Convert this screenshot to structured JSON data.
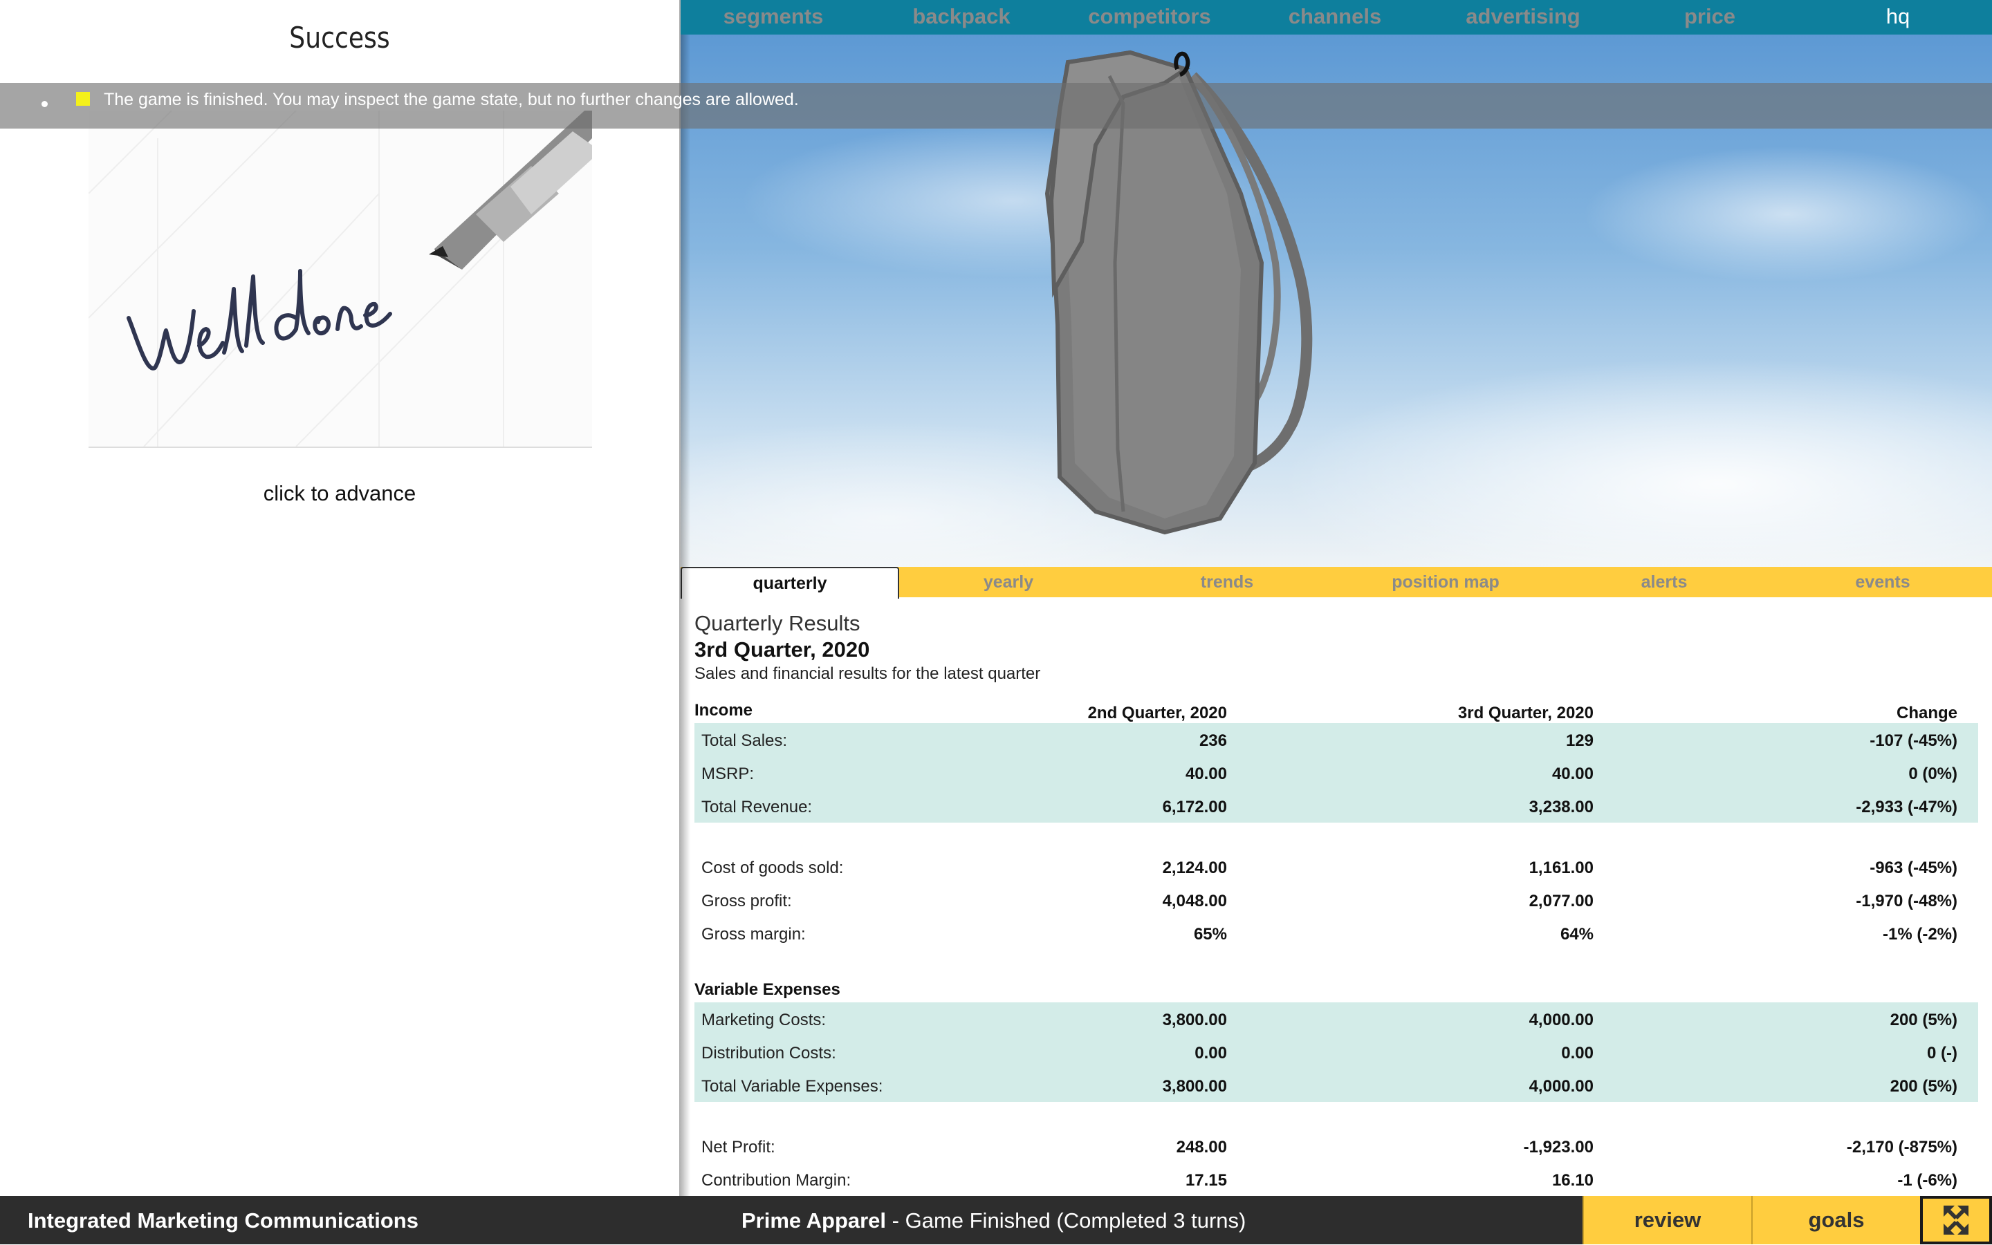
{
  "success_panel": {
    "title": "Success",
    "advance_label": "click to advance",
    "image_alt": "Well done"
  },
  "notice": {
    "text": "The game is finished. You may inspect the game state, but no further changes are allowed.",
    "marker_color": "#f4f11a"
  },
  "top_nav": {
    "items": [
      {
        "label": "segments"
      },
      {
        "label": "backpack"
      },
      {
        "label": "competitors"
      },
      {
        "label": "channels"
      },
      {
        "label": "advertising"
      },
      {
        "label": "price"
      },
      {
        "label": "hq"
      }
    ],
    "background": "#0e7f9d"
  },
  "tabs": {
    "items": [
      {
        "label": "quarterly",
        "active": true
      },
      {
        "label": "yearly"
      },
      {
        "label": "trends"
      },
      {
        "label": "position map"
      },
      {
        "label": "alerts"
      },
      {
        "label": "events"
      }
    ],
    "accent": "#ffcd3f"
  },
  "results": {
    "heading": "Quarterly Results",
    "period": "3rd Quarter, 2020",
    "description": "Sales and financial results for the latest quarter",
    "income_header": "Income",
    "variable_header": "Variable Expenses",
    "columns": [
      "2nd Quarter, 2020",
      "3rd Quarter, 2020",
      "Change"
    ],
    "rows": [
      {
        "label": "Total Sales:",
        "q2": "236",
        "q3": "129",
        "change": "-107 (-45%)"
      },
      {
        "label": "MSRP:",
        "q2": "40.00",
        "q3": "40.00",
        "change": "0 (0%)"
      },
      {
        "label": "Total Revenue:",
        "q2": "6,172.00",
        "q3": "3,238.00",
        "change": "-2,933 (-47%)"
      },
      {
        "label": "Cost of goods sold:",
        "q2": "2,124.00",
        "q3": "1,161.00",
        "change": "-963 (-45%)"
      },
      {
        "label": "Gross profit:",
        "q2": "4,048.00",
        "q3": "2,077.00",
        "change": "-1,970 (-48%)"
      },
      {
        "label": "Gross margin:",
        "q2": "65%",
        "q3": "64%",
        "change": "-1% (-2%)"
      },
      {
        "label": "Marketing Costs:",
        "q2": "3,800.00",
        "q3": "4,000.00",
        "change": "200 (5%)"
      },
      {
        "label": "Distribution Costs:",
        "q2": "0.00",
        "q3": "0.00",
        "change": "0 (-)"
      },
      {
        "label": "Total Variable Expenses:",
        "q2": "3,800.00",
        "q3": "4,000.00",
        "change": "200 (5%)"
      },
      {
        "label": "Net Profit:",
        "q2": "248.00",
        "q3": "-1,923.00",
        "change": "-2,170 (-875%)"
      },
      {
        "label": "Contribution Margin:",
        "q2": "17.15",
        "q3": "16.10",
        "change": "-1 (-6%)"
      }
    ],
    "row_highlight": "#d3ece8"
  },
  "bottom_bar": {
    "course_title": "Integrated Marketing Communications",
    "company": "Prime Apparel",
    "status": " - Game Finished (Completed 3 turns)",
    "review_label": "review",
    "goals_label": "goals",
    "fullscreen_icon": "fullscreen-icon"
  }
}
